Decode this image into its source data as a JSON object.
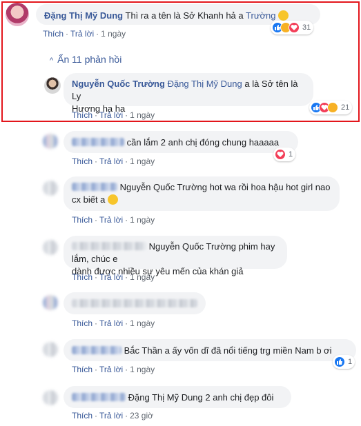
{
  "comments": [
    {
      "author": "Đặng Thị Mỹ Dung",
      "text_before": "Thì ra a tên là Sở Khanh hả a",
      "tag": "Trường",
      "actions": {
        "like": "Thích",
        "reply": "Trả lời",
        "time": "1 ngày"
      },
      "reactions": {
        "types": [
          "like-icon",
          "haha-icon",
          "love-icon"
        ],
        "count": "31"
      }
    },
    {
      "author": "Nguyễn Quốc Trường",
      "tag": "Đặng Thị Mỹ Dung",
      "text_line1": "a là Sở tên là Ly",
      "text_line2": "Hương ha ha",
      "actions": {
        "like": "Thích",
        "reply": "Trả lời",
        "time": "1 ngày"
      },
      "reactions": {
        "types": [
          "like-icon",
          "love-icon",
          "haha-icon"
        ],
        "count": "21"
      }
    },
    {
      "text": "cần lắm 2 anh chị đóng chung haaaaa",
      "actions": {
        "like": "Thích",
        "reply": "Trả lời",
        "time": "1 ngày"
      },
      "reactions": {
        "types": [
          "love-icon"
        ],
        "count": "1"
      }
    },
    {
      "line1": "Nguyễn Quốc Trường hot wa rồi hoa hậu hot girl nao",
      "line2": "cx biết a",
      "actions": {
        "like": "Thích",
        "reply": "Trả lời",
        "time": "1 ngày"
      }
    },
    {
      "line1": "Nguyễn Quốc Trường phim hay lắm, chúc e",
      "line2": "dành được nhiều sự yêu mến của khán giả",
      "actions": {
        "like": "Thích",
        "reply": "Trả lời",
        "time": "1 ngày"
      }
    },
    {
      "actions": {
        "like": "Thích",
        "reply": "Trả lời",
        "time": "1 ngày"
      }
    },
    {
      "text": "Bắc Thần a ấy vốn dĩ đã nổi tiếng trg miền Nam b ơi",
      "actions": {
        "like": "Thích",
        "reply": "Trả lời",
        "time": "1 ngày"
      },
      "reactions": {
        "types": [
          "like-icon"
        ],
        "count": "1"
      }
    },
    {
      "text": "Đặng Thị Mỹ Dung 2 anh chị đẹp đôi",
      "actions": {
        "like": "Thích",
        "reply": "Trả lời",
        "time": "23 giờ"
      }
    }
  ],
  "hide_replies": {
    "label": "Ẩn 11 phản hồi",
    "icon": "chevron-up-icon"
  },
  "colors": {
    "link": "#385898",
    "bubble": "#f2f3f5",
    "highlight": "#e3151b",
    "like": "#1877f2",
    "love": "#f33e58",
    "haha": "#f7b125"
  }
}
